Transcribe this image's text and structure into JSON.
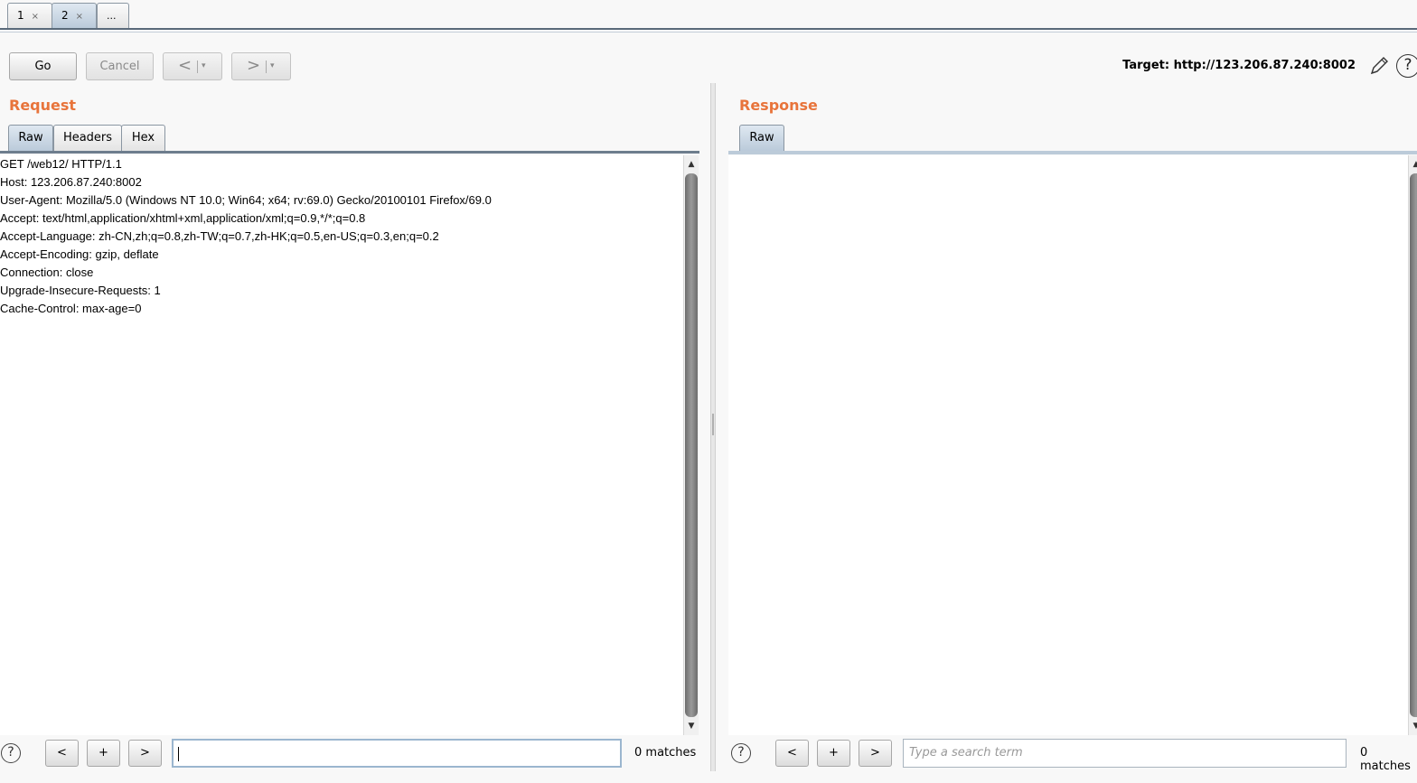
{
  "top_tabs": [
    {
      "label": "1",
      "close": "×"
    },
    {
      "label": "2",
      "close": "×"
    },
    {
      "label": "..."
    }
  ],
  "toolbar": {
    "go_label": "Go",
    "cancel_label": "Cancel",
    "back_arrow": "<",
    "forward_arrow": ">",
    "dropdown_glyph": "▾",
    "target_text": "Target: http://123.206.87.240:8002",
    "help_glyph": "?"
  },
  "request": {
    "title": "Request",
    "tabs": [
      "Raw",
      "Headers",
      "Hex"
    ],
    "lines": [
      "GET /web12/ HTTP/1.1",
      "Host: 123.206.87.240:8002",
      "User-Agent: Mozilla/5.0 (Windows NT 10.0; Win64; x64; rv:69.0) Gecko/20100101 Firefox/69.0",
      "Accept: text/html,application/xhtml+xml,application/xml;q=0.9,*/*;q=0.8",
      "Accept-Language: zh-CN,zh;q=0.8,zh-TW;q=0.7,zh-HK;q=0.5,en-US;q=0.3,en;q=0.2",
      "Accept-Encoding: gzip, deflate",
      "Connection: close",
      "Upgrade-Insecure-Requests: 1",
      "Cache-Control: max-age=0"
    ],
    "search": {
      "value": "",
      "placeholder": "",
      "matches": "0 matches"
    }
  },
  "response": {
    "title": "Response",
    "tabs": [
      "Raw"
    ],
    "search": {
      "value": "",
      "placeholder": "Type a search term",
      "matches": "0 matches"
    }
  },
  "search_buttons": {
    "prev": "<",
    "add": "+",
    "next": ">",
    "help": "?"
  }
}
